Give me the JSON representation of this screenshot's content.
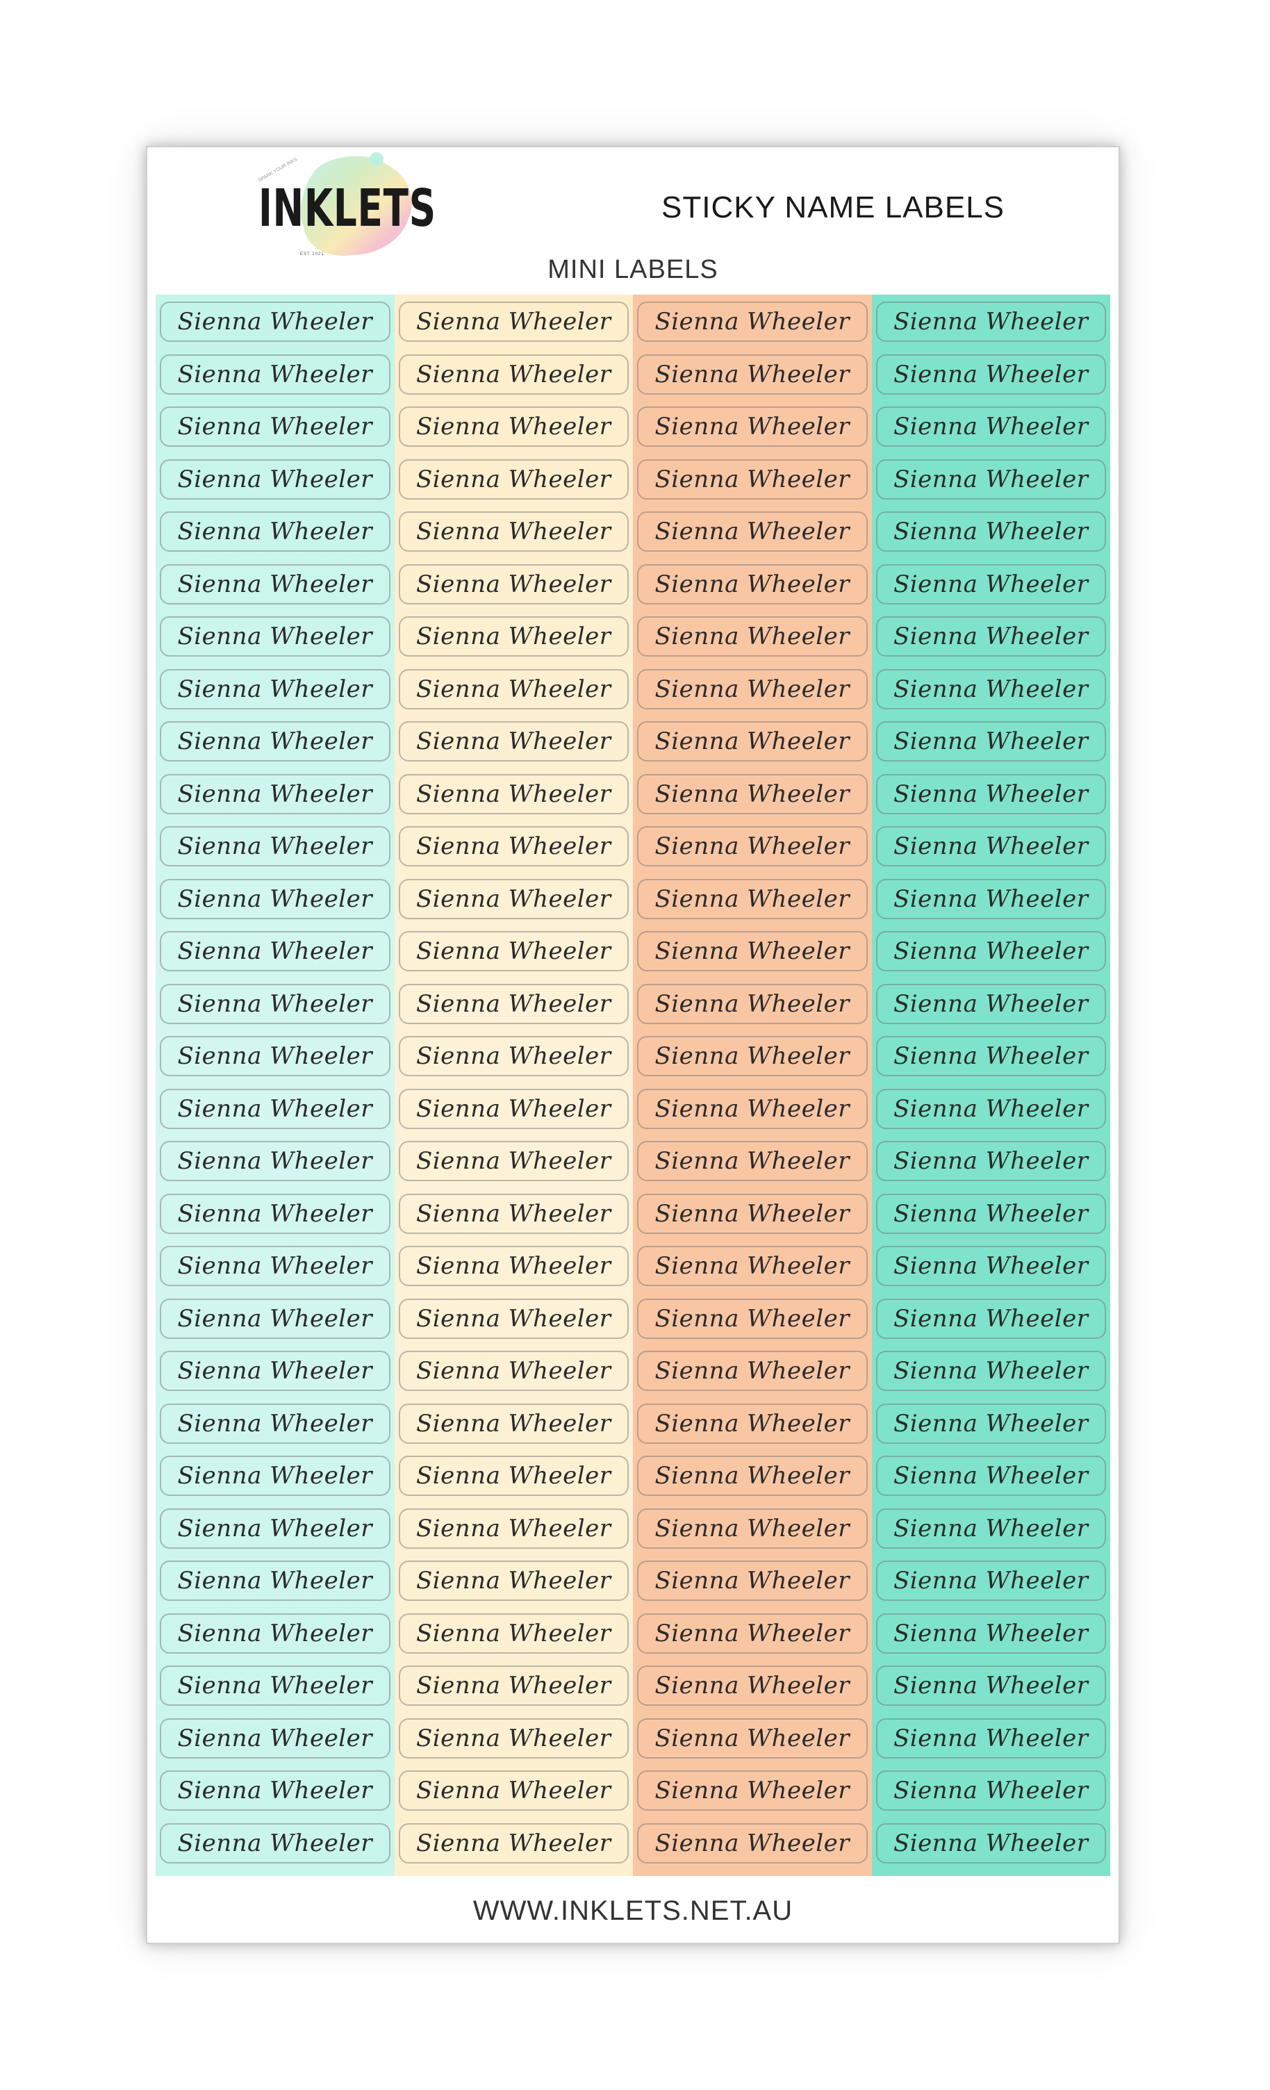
{
  "brand": {
    "logo_text": "INKLETS",
    "logo_tagline": "EST 2021",
    "logo_colors": [
      "#b8f0e0",
      "#f7e6a8",
      "#f4b6c8",
      "#cfc6f4"
    ]
  },
  "header": {
    "title": "STICKY NAME LABELS",
    "subtitle": "MINI LABELS"
  },
  "label_name": "Sienna Wheeler",
  "columns": [
    {
      "color": "#c8f5ec"
    },
    {
      "color": "#fdf0d0"
    },
    {
      "color": "#f9c6a4"
    },
    {
      "color": "#7fe3cb"
    }
  ],
  "rows_per_column": 30,
  "footer": {
    "website": "WWW.INKLETS.NET.AU"
  }
}
